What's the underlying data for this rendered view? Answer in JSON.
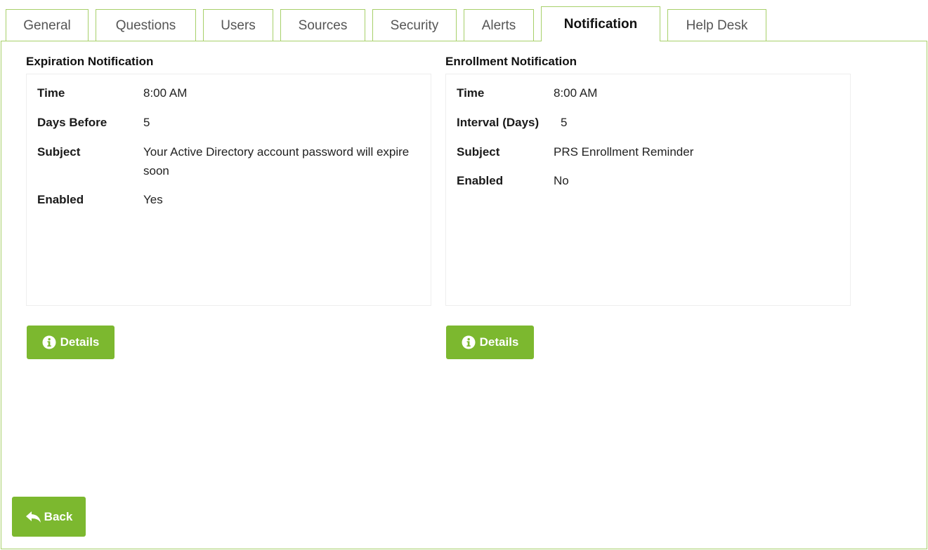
{
  "tabs": [
    {
      "label": "General"
    },
    {
      "label": "Questions"
    },
    {
      "label": "Users"
    },
    {
      "label": "Sources"
    },
    {
      "label": "Security"
    },
    {
      "label": "Alerts"
    },
    {
      "label": "Notification",
      "active": true
    },
    {
      "label": "Help Desk"
    }
  ],
  "expiration": {
    "title": "Expiration Notification",
    "time_label": "Time",
    "time_value": "8:00 AM",
    "days_label": "Days Before",
    "days_value": "5",
    "subject_label": "Subject",
    "subject_value": "Your Active Directory account password will expire soon",
    "enabled_label": "Enabled",
    "enabled_value": "Yes",
    "details_button": "Details"
  },
  "enrollment": {
    "title": "Enrollment Notification",
    "time_label": "Time",
    "time_value": "8:00 AM",
    "interval_label": "Interval (Days)",
    "interval_value": "5",
    "subject_label": "Subject",
    "subject_value": "PRS Enrollment Reminder",
    "enabled_label": "Enabled",
    "enabled_value": "No",
    "details_button": "Details"
  },
  "back_button": "Back",
  "colors": {
    "accent": "#7cb82f",
    "tab_border": "#a7d06a"
  },
  "icons": {
    "details": "info-circle-icon",
    "back": "reply-arrow-icon"
  }
}
